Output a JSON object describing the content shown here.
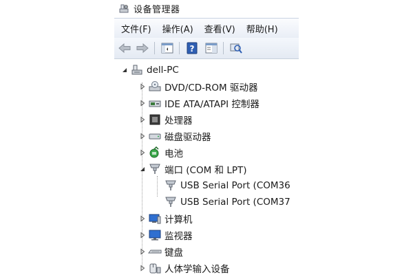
{
  "window": {
    "title": "设备管理器"
  },
  "menu": [
    {
      "label": "文件(F)"
    },
    {
      "label": "操作(A)"
    },
    {
      "label": "查看(V)"
    },
    {
      "label": "帮助(H)"
    }
  ],
  "toolbar": {
    "icons": [
      "back-arrow-icon",
      "forward-arrow-icon",
      "show-hide-tree-icon",
      "help-icon",
      "properties-icon",
      "scan-hardware-icon"
    ]
  },
  "tree": {
    "root": {
      "label": "dell-PC",
      "expanded": true
    },
    "categories": [
      {
        "label": "DVD/CD-ROM 驱动器",
        "icon": "dvd-drive-icon",
        "expanded": false
      },
      {
        "label": "IDE ATA/ATAPI 控制器",
        "icon": "ide-controller-icon",
        "expanded": false
      },
      {
        "label": "处理器",
        "icon": "processor-icon",
        "expanded": false
      },
      {
        "label": "磁盘驱动器",
        "icon": "disk-drive-icon",
        "expanded": false
      },
      {
        "label": "电池",
        "icon": "battery-icon",
        "expanded": false
      },
      {
        "label": "端口 (COM 和 LPT)",
        "icon": "port-icon",
        "expanded": true,
        "children": [
          {
            "label": "USB Serial Port (COM36"
          },
          {
            "label": "USB Serial Port (COM37"
          }
        ]
      },
      {
        "label": "计算机",
        "icon": "computer-icon",
        "expanded": false
      },
      {
        "label": "监视器",
        "icon": "monitor-icon",
        "expanded": false
      },
      {
        "label": "键盘",
        "icon": "keyboard-icon",
        "expanded": false
      },
      {
        "label": "人体学输入设备",
        "icon": "hid-icon",
        "expanded": false
      }
    ]
  }
}
